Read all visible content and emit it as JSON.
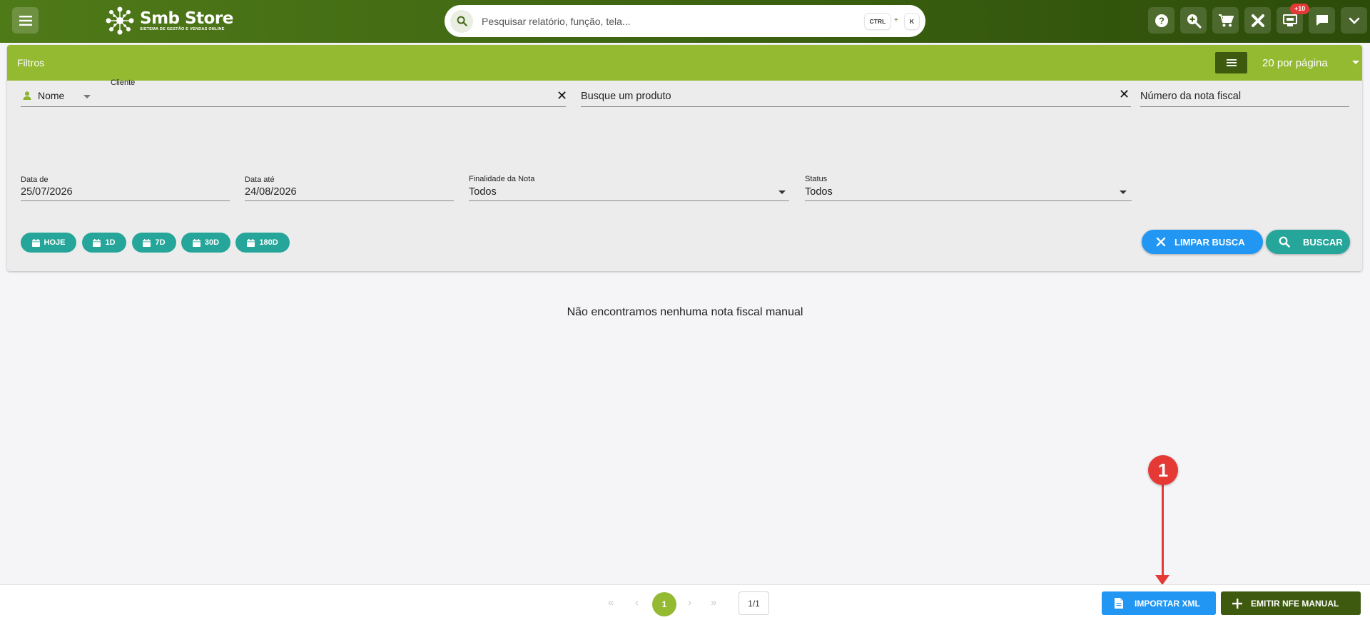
{
  "topbar": {
    "brand_title": "Smb Store",
    "brand_subtitle": "SISTEMA DE GESTÃO E VENDAS ONLINE",
    "search_placeholder": "Pesquisar relatório, função, tela...",
    "shortcut_ctrl": "CTRL",
    "shortcut_plus": "+",
    "shortcut_key": "K",
    "notification_badge": "+10",
    "icons": [
      "help-icon",
      "zoom-in-icon",
      "cart-icon",
      "tools-icon",
      "register-icon",
      "chat-icon",
      "chevron-down-icon"
    ]
  },
  "filters": {
    "title": "Filtros",
    "per_page": "20 por página",
    "cliente_label": "Cliente",
    "cliente_type": "Nome",
    "produto_placeholder": "Busque um produto",
    "nota_placeholder": "Número da nota fiscal",
    "data_de_label": "Data de",
    "data_de_value": "25/07/2026",
    "data_ate_label": "Data até",
    "data_ate_value": "24/08/2026",
    "finalidade_label": "Finalidade da Nota",
    "finalidade_value": "Todos",
    "status_label": "Status",
    "status_value": "Todos",
    "chips": [
      "HOJE",
      "1D",
      "7D",
      "30D",
      "180D"
    ],
    "limpar_label": "LIMPAR BUSCA",
    "buscar_label": "BUSCAR"
  },
  "main": {
    "empty_message": "Não encontramos nenhuma nota fiscal manual"
  },
  "footer": {
    "current_page": "1",
    "page_info": "1/1",
    "importar_label": "IMPORTAR XML",
    "emitir_label": "EMITIR NFE MANUAL"
  },
  "annotation": {
    "step_number": "1"
  },
  "colors": {
    "topbar": "#3d6411",
    "filter_header": "#93ba31",
    "teal": "#26a69a",
    "blue": "#2196f3",
    "dark_green": "#3d5a0f",
    "annotation_red": "#e53935"
  }
}
